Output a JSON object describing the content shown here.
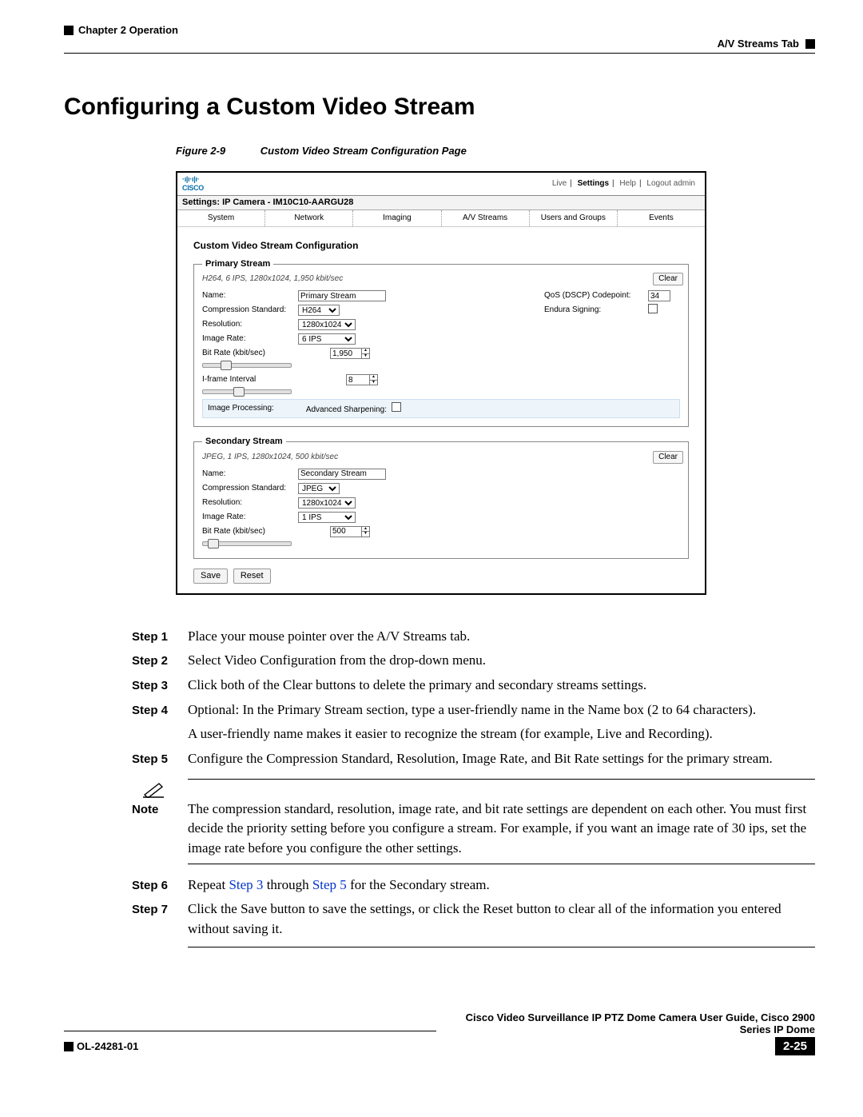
{
  "header": {
    "chapter": "Chapter 2    Operation",
    "tab": "A/V Streams Tab"
  },
  "section_title": "Configuring a Custom Video Stream",
  "figure": {
    "num": "Figure 2-9",
    "caption": "Custom Video Stream Configuration Page"
  },
  "screenshot": {
    "links": {
      "live": "Live",
      "settings": "Settings",
      "help": "Help",
      "logout": "Logout admin"
    },
    "title": "Settings: IP Camera - IM10C10-AARGU28",
    "tabs": [
      "System",
      "Network",
      "Imaging",
      "A/V Streams",
      "Users and Groups",
      "Events"
    ],
    "heading": "Custom Video Stream Configuration",
    "primary": {
      "legend": "Primary Stream",
      "summary": "H264, 6 IPS, 1280x1024, 1,950 kbit/sec",
      "clear": "Clear",
      "name_label": "Name:",
      "name_value": "Primary Stream",
      "qos_label": "QoS (DSCP) Codepoint:",
      "qos_value": "34",
      "comp_label": "Compression Standard:",
      "comp_value": "H264",
      "endura_label": "Endura Signing:",
      "res_label": "Resolution:",
      "res_value": "1280x1024",
      "img_label": "Image Rate:",
      "img_value": "6 IPS",
      "bit_label": "Bit Rate (kbit/sec)",
      "bit_value": "1,950",
      "iframe_label": "I-frame Interval",
      "iframe_value": "8",
      "proc_label": "Image Processing:",
      "sharp_label": "Advanced Sharpening:"
    },
    "secondary": {
      "legend": "Secondary Stream",
      "summary": "JPEG, 1 IPS, 1280x1024, 500 kbit/sec",
      "clear": "Clear",
      "name_label": "Name:",
      "name_value": "Secondary Stream",
      "comp_label": "Compression Standard:",
      "comp_value": "JPEG",
      "res_label": "Resolution:",
      "res_value": "1280x1024",
      "img_label": "Image Rate:",
      "img_value": "1 IPS",
      "bit_label": "Bit Rate (kbit/sec)",
      "bit_value": "500"
    },
    "save": "Save",
    "reset": "Reset"
  },
  "steps": {
    "s1_label": "Step 1",
    "s1": "Place your mouse pointer over the A/V Streams tab.",
    "s2_label": "Step 2",
    "s2": "Select Video Configuration from the drop-down menu.",
    "s3_label": "Step 3",
    "s3": "Click both of the Clear buttons to delete the primary and secondary streams settings.",
    "s4_label": "Step 4",
    "s4": "Optional: In the Primary Stream section, type a user-friendly name in the Name box (2 to 64 characters).",
    "s4b": "A user-friendly name makes it easier to recognize the stream (for example, Live and Recording).",
    "s5_label": "Step 5",
    "s5": "Configure the Compression Standard, Resolution, Image Rate, and Bit Rate settings for the primary stream.",
    "note_label": "Note",
    "note": "The compression standard, resolution, image rate, and bit rate settings are dependent on each other. You must first decide the priority setting before you configure a stream. For example, if you want an image rate of 30 ips, set the image rate before you configure the other settings.",
    "s6_label": "Step 6",
    "s6_a": "Repeat ",
    "s6_link1": "Step 3",
    "s6_b": " through ",
    "s6_link2": "Step 5",
    "s6_c": " for the Secondary stream.",
    "s7_label": "Step 7",
    "s7": "Click the Save button to save the settings, or click the Reset button to clear all of the information you entered without saving it."
  },
  "footer": {
    "title": "Cisco Video Surveillance IP PTZ Dome Camera User Guide, Cisco 2900 Series IP Dome",
    "doc": "OL-24281-01",
    "page": "2-25"
  }
}
